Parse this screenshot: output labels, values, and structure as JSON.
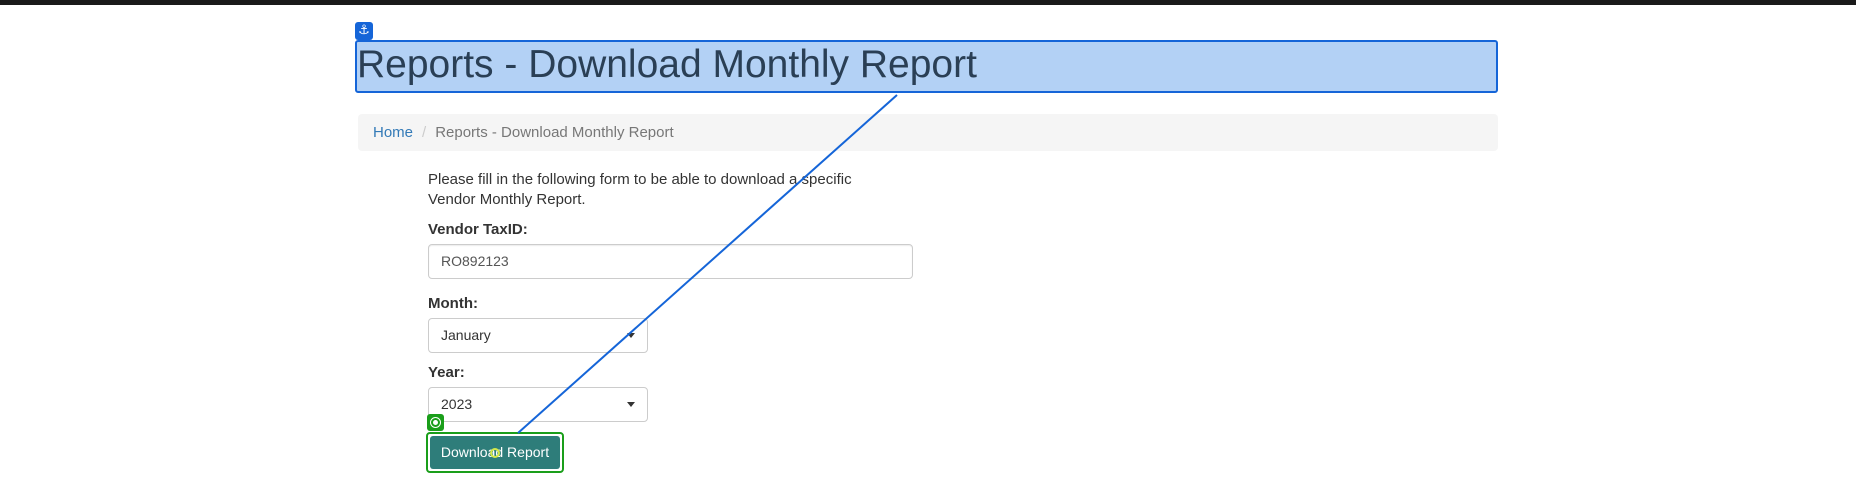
{
  "page": {
    "title": "Reports - Download Monthly Report"
  },
  "breadcrumb": {
    "home": "Home",
    "separator": "/",
    "current": "Reports - Download Monthly Report"
  },
  "form": {
    "intro": "Please fill in the following form to be able to download a specific Vendor Monthly Report.",
    "vendor_taxid": {
      "label": "Vendor TaxID:",
      "value": "RO892123"
    },
    "month": {
      "label": "Month:",
      "selected": "January"
    },
    "year": {
      "label": "Year:",
      "selected": "2023"
    },
    "submit_label": "Download Report"
  },
  "annotations": {
    "anchor_icon": "anchor-icon",
    "target_icon": "target-icon",
    "highlight_color": "#1565d8",
    "target_color": "#1a9e1a"
  }
}
